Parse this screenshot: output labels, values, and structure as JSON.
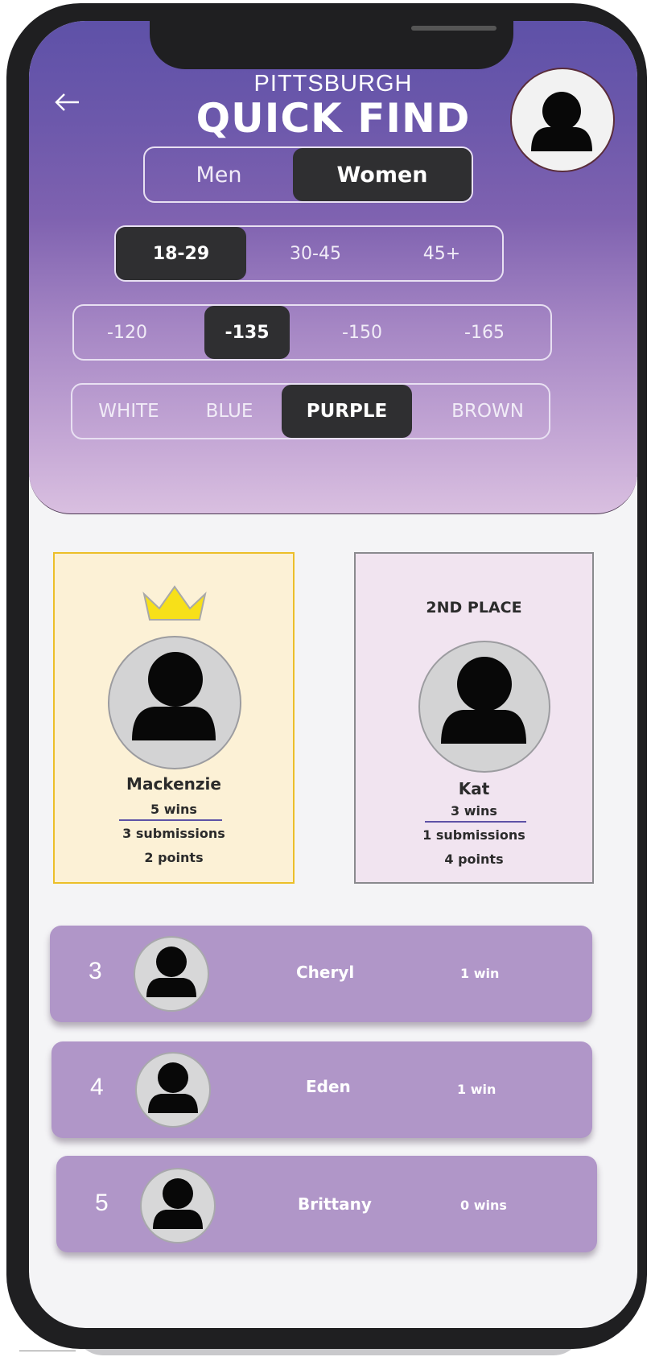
{
  "header": {
    "city": "PITTSBURGH",
    "title": "QUICK FIND",
    "back_icon": "arrow-left-icon",
    "profile_icon": "user-avatar-icon"
  },
  "gender_tabs": {
    "options": [
      "Men",
      "Women"
    ],
    "selected": "Women"
  },
  "age_tabs": {
    "options": [
      "18-29",
      "30-45",
      "45+"
    ],
    "selected": "18-29"
  },
  "weight_tabs": {
    "options": [
      "-120",
      "-135",
      "-150",
      "-165"
    ],
    "selected": "-135"
  },
  "belt_tabs": {
    "options": [
      "WHITE",
      "BLUE",
      "PURPLE",
      "BROWN"
    ],
    "selected": "PURPLE"
  },
  "first_place": {
    "icon": "crown-icon",
    "name": "Mackenzie",
    "wins": "5 wins",
    "submissions": "3 submissions",
    "points": "2 points"
  },
  "second_place": {
    "label": "2ND PLACE",
    "name": "Kat",
    "wins": "3 wins",
    "submissions": "1 submissions",
    "points": "4 points"
  },
  "rankings": [
    {
      "rank": "3",
      "name": "Cheryl",
      "wins": "1 win"
    },
    {
      "rank": "4",
      "name": "Eden",
      "wins": "1 win"
    },
    {
      "rank": "5",
      "name": "Brittany",
      "wins": "0 wins"
    }
  ],
  "colors": {
    "header_top": "#5e51a8",
    "header_bottom": "#d9bfe0",
    "active_tab": "#2f2f31",
    "first_card": "#fcf1d6",
    "first_border": "#ecbf29",
    "second_card": "#f1e4f0",
    "row_bg": "#b096c8",
    "crown": "#f7e019"
  }
}
